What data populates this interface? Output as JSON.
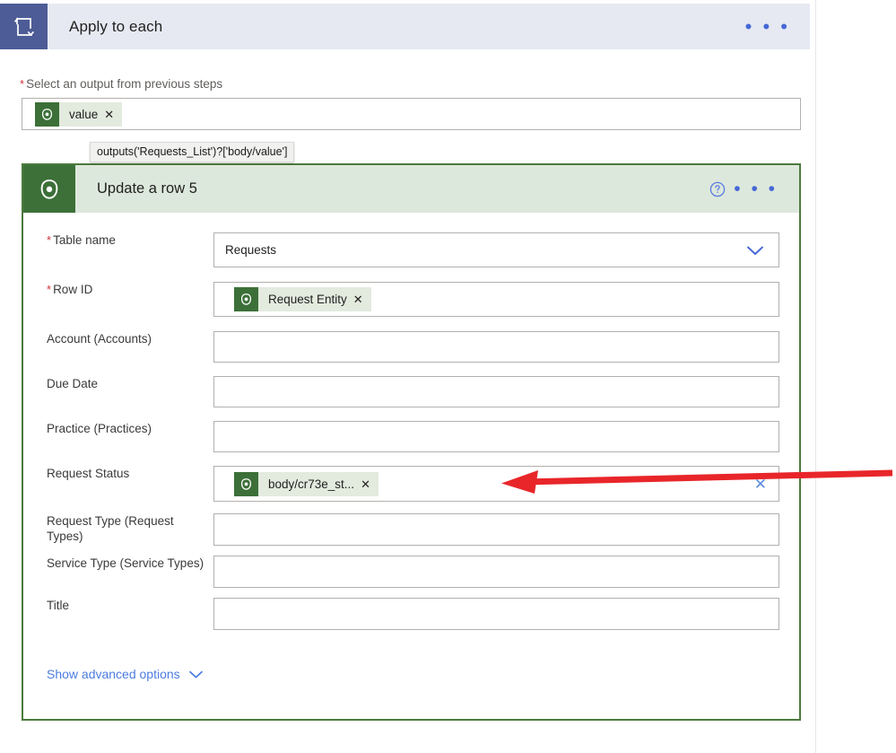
{
  "loop": {
    "icon": "loop-repeat-icon",
    "title": "Apply to each",
    "ellipsis": "• • •",
    "input_label": "Select an output from previous steps",
    "required_marker": "*",
    "token": {
      "icon": "dataverse-icon",
      "text": "value",
      "remove": "✕"
    },
    "tooltip": "outputs('Requests_List')?['body/value']"
  },
  "card": {
    "icon": "dataverse-icon",
    "title": "Update a row 5",
    "help_icon": "help-circle-icon",
    "ellipsis": "• • •",
    "show_advanced_label": "Show advanced options",
    "show_advanced_chevron": "chevron-down-icon",
    "fields": [
      {
        "label": "Table name",
        "required": true,
        "type": "dropdown",
        "value": "Requests",
        "chevron": "chevron-down-icon"
      },
      {
        "label": "Row ID",
        "required": true,
        "type": "token",
        "token": {
          "icon": "dataverse-icon",
          "text": "Request Entity",
          "remove": "✕"
        }
      },
      {
        "label": "Account (Accounts)",
        "required": false,
        "type": "text",
        "value": ""
      },
      {
        "label": "Due Date",
        "required": false,
        "type": "text",
        "value": ""
      },
      {
        "label": "Practice (Practices)",
        "required": false,
        "type": "text",
        "value": ""
      },
      {
        "label": "Request Status",
        "required": false,
        "type": "token",
        "token": {
          "icon": "dataverse-icon",
          "text": "body/cr73e_st...",
          "remove": "✕"
        },
        "clear": "✕"
      },
      {
        "label": "Request Type (Request Types)",
        "required": false,
        "type": "text",
        "value": ""
      },
      {
        "label": "Service Type (Service Types)",
        "required": false,
        "type": "text",
        "value": ""
      },
      {
        "label": "Title",
        "required": false,
        "type": "text",
        "value": ""
      }
    ]
  },
  "annotation": {
    "name": "red-arrow-pointing-to-request-status",
    "color": "#e8262a"
  },
  "colors": {
    "loop_header_bg": "#e6e9f2",
    "loop_icon_bg": "#4d5c96",
    "card_border": "#4c7a3e",
    "card_header_bg": "#dde8dc",
    "card_icon_bg": "#3c7038",
    "chip_bg": "#e3eade",
    "link_blue": "#4c7ce0",
    "required_red": "#d13438"
  }
}
